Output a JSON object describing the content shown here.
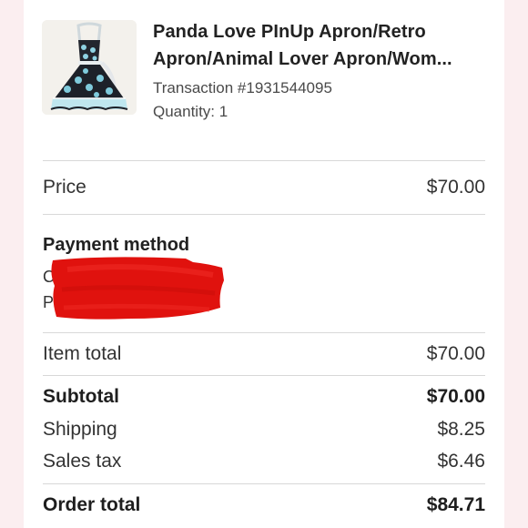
{
  "product": {
    "title_line1": "Panda Love PInUp Apron/Retro",
    "title_line2": "Apron/Animal Lover Apron/Wom...",
    "transaction": "Transaction #1931544095",
    "quantity": "Quantity: 1",
    "thumbnail_icon": "apron-thumbnail"
  },
  "price": {
    "label": "Price",
    "value": "$70.00"
  },
  "payment": {
    "title": "Payment method",
    "line1_visible": "C",
    "line2_visible": "P",
    "redaction_color": "#e0120e"
  },
  "totals": {
    "item_total_label": "Item total",
    "item_total_value": "$70.00",
    "subtotal_label": "Subtotal",
    "subtotal_value": "$70.00",
    "shipping_label": "Shipping",
    "shipping_value": "$8.25",
    "sales_tax_label": "Sales tax",
    "sales_tax_value": "$6.46",
    "order_total_label": "Order total",
    "order_total_value": "$84.71"
  }
}
